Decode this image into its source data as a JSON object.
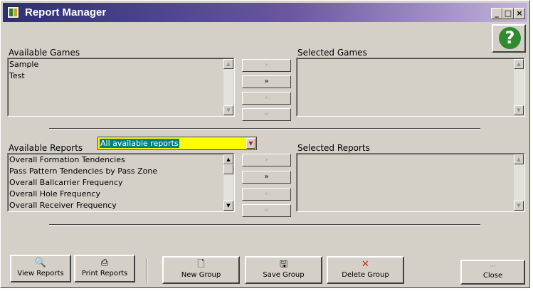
{
  "window": {
    "title": "Report Manager",
    "controls": {
      "minimize": "_",
      "maximize": "□",
      "close": "×"
    }
  },
  "help": {
    "label": "?"
  },
  "games": {
    "available_label": "Available Games",
    "selected_label": "Selected Games",
    "available_items": [
      "Sample",
      "Test"
    ],
    "selected_items": []
  },
  "games_transfer": {
    "add": "›",
    "add_all": "»",
    "remove": "‹",
    "remove_all": "«"
  },
  "reports": {
    "available_label": "Available Reports",
    "selected_label": "Selected Reports",
    "filter_value": "All available reports",
    "available_items": [
      "Overall Formation Tendencies",
      "Pass Pattern Tendencies by Pass Zone",
      "Overall Ballcarrier Frequency",
      "Overall Hole Frequency",
      "Overall Receiver Frequency"
    ],
    "selected_items": []
  },
  "reports_transfer": {
    "add": "›",
    "add_all": "»",
    "remove": "‹",
    "remove_all": "«"
  },
  "toolbar": {
    "view_reports": "View Reports",
    "print_reports": "Print Reports",
    "new_group": "New Group",
    "save_group": "Save Group",
    "delete_group": "Delete Group",
    "close": "Close"
  },
  "icons": {
    "view": "magnifier-page-icon",
    "print": "printer-icon",
    "new": "blank-page-icon",
    "save": "floppy-disk-icon",
    "delete": "red-x-icon",
    "close": "exit-icon"
  },
  "colors": {
    "title_start": "#2c2f78",
    "title_end": "#c4b2dc",
    "face": "#d4d0c8",
    "filter_bg": "#ffff00",
    "filter_highlight": "#008080",
    "help_green": "#2e8b2e",
    "delete_red": "#d02020"
  }
}
